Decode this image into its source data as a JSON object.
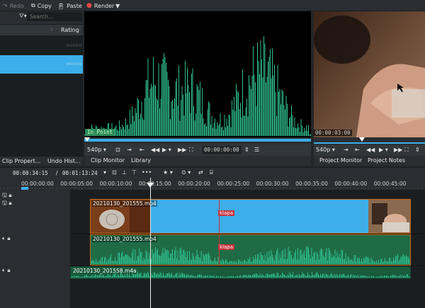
{
  "toolbar": {
    "redo_label": "Redo",
    "copy_label": "Copy",
    "paste_label": "Paste",
    "render_label": "Render"
  },
  "bin": {
    "search_placeholder": "Search...",
    "rating_header": "Rating",
    "stars": "☆☆☆☆☆"
  },
  "bottom_tabs": {
    "clip_properties": "Clip Propert...",
    "undo_history": "Undo Hist..."
  },
  "clip_monitor": {
    "inpoint_label": "In Point",
    "resolution": "540p",
    "timecode": "00:00:00:00",
    "tab_clip_monitor": "Clip Monitor",
    "tab_library": "Library"
  },
  "project_monitor": {
    "timecode": "00:00:03:00",
    "resolution": "540p",
    "tab_project_monitor": "Project Monitor",
    "tab_project_notes": "Project Notes"
  },
  "timeline": {
    "position": "00:00:34:15",
    "separator": "/",
    "duration": "00:01:13:24",
    "ruler_labels": [
      "00:00:00:00",
      "00:00:05:00",
      "00:00:10:00",
      "00:00:15:00",
      "00:00:20:00",
      "00:00:25:00",
      "00:00:30:00",
      "00:00:35:00",
      "00:00:40:00",
      "00:00:45:00"
    ],
    "video_clip_name": "20210130_201555.mp4",
    "audio_clip_name": "20210130_201555.mp4",
    "audio2_clip_name": "20210130_201558.m4a",
    "marker_label": "klapa"
  },
  "colors": {
    "selection": "#3daee9",
    "waveform": "#2fbf8f",
    "clip_border": "#c86a1a",
    "audio_clip_bg": "#1f6b46",
    "marker": "#c8323c"
  }
}
